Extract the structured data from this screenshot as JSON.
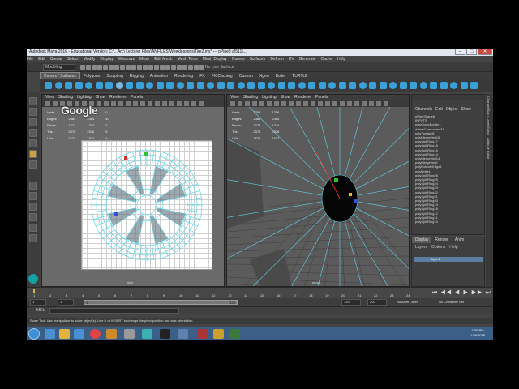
{
  "window": {
    "title": "Autodesk Maya 2016 - Educational Version: C:\\...Arc\\ Lecturer Files\\ANFILES\\Weeklessons\\Tire2.mx* --- pPipe8 a[511]...",
    "minimize": "–",
    "maximize": "□",
    "close": "✕"
  },
  "menubar": [
    "File",
    "Edit",
    "Create",
    "Select",
    "Modify",
    "Display",
    "Windows",
    "Mesh",
    "Edit Mesh",
    "Mesh Tools",
    "Mesh Display",
    "Curves",
    "Surfaces",
    "Deform",
    "UV",
    "Generate",
    "Cache",
    "Help"
  ],
  "statusline": {
    "mode": "Modeling",
    "live_surface": "No Live Surface"
  },
  "shelf_tabs": [
    {
      "label": "Curves / Surfaces",
      "active": true
    },
    {
      "label": "Polygons",
      "active": false
    },
    {
      "label": "Sculpting",
      "active": false
    },
    {
      "label": "Rigging",
      "active": false
    },
    {
      "label": "Animation",
      "active": false
    },
    {
      "label": "Rendering",
      "active": false
    },
    {
      "label": "FX",
      "active": false
    },
    {
      "label": "FX Caching",
      "active": false
    },
    {
      "label": "Custom",
      "active": false
    },
    {
      "label": "Xgen",
      "active": false
    },
    {
      "label": "Bullet",
      "active": false
    },
    {
      "label": "TURTLE",
      "active": false
    }
  ],
  "viewport_menu": [
    "View",
    "Shading",
    "Lighting",
    "Show",
    "Renderer",
    "Panels"
  ],
  "viewport_left": {
    "hud": [
      [
        "Verts:",
        "1256",
        "1256",
        "0"
      ],
      [
        "Edges:",
        "2384",
        "2384",
        "40"
      ],
      [
        "Faces:",
        "1274",
        "1274",
        "0"
      ],
      [
        "Tris:",
        "2376",
        "2376",
        "0"
      ],
      [
        "UVs:",
        "1622",
        "1622",
        "0"
      ]
    ],
    "camera": "side"
  },
  "viewport_right": {
    "hud": [
      [
        "Verts:",
        "1256",
        "1256",
        ""
      ],
      [
        "Edges:",
        "2384",
        "2384",
        ""
      ],
      [
        "Faces:",
        "1274",
        "1274",
        ""
      ],
      [
        "Tris:",
        "2376",
        "2376",
        ""
      ],
      [
        "UVs:",
        "1622",
        "1622",
        ""
      ]
    ],
    "camera": "persp"
  },
  "watermark": "Google",
  "channel_box": {
    "tabs": [
      "Channels",
      "Edit",
      "Object",
      "Show"
    ],
    "object": "pPipeShape8",
    "inputs_label": "INPUTS",
    "items": [
      "polyCloseBorder1",
      "deleteComponent11",
      "polyTweak18",
      "polyMergeVert15",
      "polySplitRing17",
      "polySplitRing16",
      "polySplitRing15",
      "polySplitRing14",
      "polyMergeVert14",
      "polyMergeVert1",
      "polyExtrudeEdge1",
      "polyUnite1",
      "polySplitRing26",
      "polySplitRing25",
      "polySplitRing24",
      "polySplitRing23",
      "polySplitRing22",
      "polySplitRing21",
      "polySplitRing20",
      "polySplitRing19",
      "polySplitRing18",
      "polySplitRing12",
      "polySplitRing11",
      "polySplitRing10"
    ]
  },
  "layers": {
    "tabs": [
      {
        "label": "Display",
        "active": true
      },
      {
        "label": "Render",
        "active": false
      },
      {
        "label": "Anim",
        "active": false
      }
    ],
    "menu": [
      "Layers",
      "Options",
      "Help"
    ],
    "layer_name": "layer1"
  },
  "attr_strip": [
    "Channel Box / Layer Editor",
    "Attribute Editor"
  ],
  "timeslider": {
    "ticks": [
      "1",
      "2",
      "3",
      "4",
      "5",
      "6",
      "7",
      "8",
      "9",
      "10",
      "11",
      "12",
      "13",
      "14",
      "15",
      "16",
      "17",
      "18",
      "19",
      "20",
      "21",
      "22",
      "23",
      "24"
    ],
    "current_frame": "1",
    "playback_controls": "⏮ ◀◀ ◀ ▶ ▶▶ ⏭"
  },
  "range": {
    "start": "1",
    "playback_start": "1",
    "range_start_label": "1",
    "range_end_label": "120",
    "playback_end": "120",
    "end": "200",
    "anim_layer": "No Anim Layer",
    "char_set": "No Character Set"
  },
  "mel_label": "MEL",
  "help_line": "Scale Tool: Use manipulator to scale object(s). Use D or INSERT to change the pivot position and axis orientation.",
  "taskbar": {
    "time": "2:30 PM",
    "date": "1/26/2018"
  },
  "colors": {
    "viewport_bg": "#6a6a6a",
    "wireframe": "#62d4e6",
    "taskbar": "#3b5f86",
    "selection": "#d0a040"
  }
}
